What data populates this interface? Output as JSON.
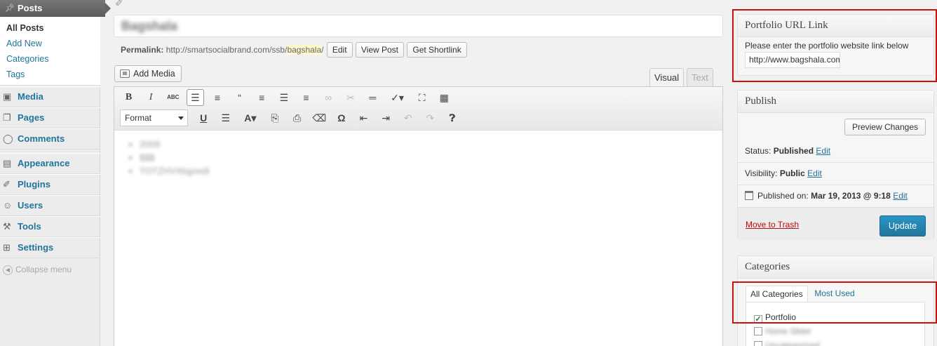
{
  "sidebar": {
    "posts_label": "Posts",
    "submenu": [
      {
        "label": "All Posts",
        "current": true
      },
      {
        "label": "Add New"
      },
      {
        "label": "Categories"
      },
      {
        "label": "Tags"
      }
    ],
    "menu": [
      {
        "label": "Media",
        "icon": "media-icon"
      },
      {
        "label": "Pages",
        "icon": "pages-icon"
      },
      {
        "label": "Comments",
        "icon": "comments-icon"
      },
      {
        "label": "Appearance",
        "icon": "appearance-icon"
      },
      {
        "label": "Plugins",
        "icon": "plugins-icon"
      },
      {
        "label": "Users",
        "icon": "users-icon"
      },
      {
        "label": "Tools",
        "icon": "tools-icon"
      },
      {
        "label": "Settings",
        "icon": "settings-icon"
      }
    ],
    "collapse_label": "Collapse menu"
  },
  "editor": {
    "title": "Bagshala",
    "permalink": {
      "label": "Permalink:",
      "base_url": "http://smartsocialbrand.com/ssb/",
      "slug": "bagshala",
      "trailing": "/",
      "edit_label": "Edit",
      "view_post_label": "View Post",
      "shortlink_label": "Get Shortlink"
    },
    "add_media_label": "Add Media",
    "tabs": {
      "visual": "Visual",
      "text": "Text"
    },
    "format_select_value": "Format",
    "content_items": [
      "2009",
      "$$$",
      "TOTZHVXbgoodi"
    ]
  },
  "portfolio_box": {
    "title": "Portfolio URL Link",
    "description": "Please enter the portfolio website link below",
    "url_value": "http://www.bagshala.com"
  },
  "publish_box": {
    "title": "Publish",
    "preview_label": "Preview Changes",
    "status_label": "Status:",
    "status_value": "Published",
    "visibility_label": "Visibility:",
    "visibility_value": "Public",
    "published_on_label": "Published on:",
    "published_on_value": "Mar 19, 2013 @ 9:18",
    "edit_label": "Edit",
    "trash_label": "Move to Trash",
    "update_label": "Update"
  },
  "categories_box": {
    "title": "Categories",
    "tabs": [
      "All Categories",
      "Most Used"
    ],
    "items": [
      {
        "label": "Portfolio",
        "checked": true
      },
      {
        "label": "Home Slider",
        "checked": false
      },
      {
        "label": "Uncategorized",
        "checked": false
      }
    ]
  },
  "colors": {
    "link": "#21759b",
    "primary_button": "#21759b",
    "trash": "#bc0b0b",
    "highlight_annotation": "#cc1111",
    "sidebar_active": "#5b5b5b"
  }
}
